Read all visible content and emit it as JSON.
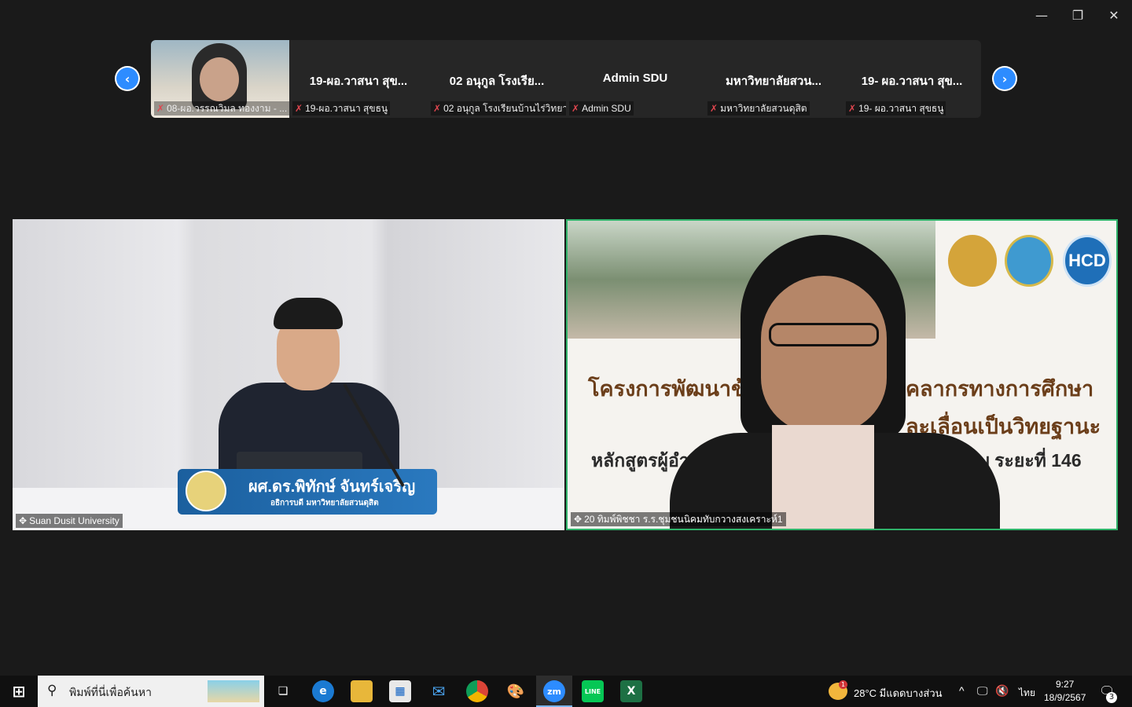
{
  "window": {
    "minimize_glyph": "—",
    "restore_glyph": "❐",
    "close_glyph": "✕"
  },
  "filmstrip": {
    "prev_glyph": "‹",
    "next_glyph": "›",
    "tiles": [
      {
        "name": "",
        "label": "08-ผอ.วรรณวิมล ทองงาม - ..."
      },
      {
        "name": "19-ผอ.วาสนา สุข...",
        "label": "19-ผอ.วาสนา สุขธนู"
      },
      {
        "name": "02 อนุกูล โรงเรีย...",
        "label": "02 อนุกูล โรงเรียนบ้านไร่วิทยา"
      },
      {
        "name": "Admin SDU",
        "label": "Admin SDU"
      },
      {
        "name": "มหาวิทยาลัยสวน...",
        "label": "มหาวิทยาลัยสวนดุสิต"
      },
      {
        "name": "19- ผอ.วาสนา สุข...",
        "label": "19- ผอ.วาสนา สุขธนู"
      }
    ]
  },
  "left_video": {
    "participant": "Suan Dusit University",
    "banner_name": "ผศ.ดร.พิทักษ์ จันทร์เจริญ",
    "banner_title": "อธิการบดี มหาวิทยาลัยสวนดุสิต"
  },
  "right_video": {
    "participant": "20 ทิมพ์พิชชา ร.ร.ชุมชนนิคมทับกวางสงเคราะห์1",
    "slide_line1a": "โครงการพัฒนาข้",
    "slide_line1b": "คลากรทางการศึกษา",
    "slide_line2": "ละเลื่อนเป็นวิทยฐานะ",
    "slide_line3a": "หลักสูตรผู้อำนว",
    "slide_line3b": "ชำนาญ ระยะที่ 146",
    "logo_hcd": "HCD"
  },
  "taskbar": {
    "search_placeholder": "พิมพ์ที่นี่เพื่อค้นหา",
    "weather": "28°C  มีแดดบางส่วน",
    "language": "ไทย",
    "time": "9:27",
    "date": "18/9/2567",
    "notification_count": "3",
    "weather_badge": "1",
    "zoom_label": "zm",
    "line_label": "LINE",
    "excel_label": "X"
  },
  "colors": {
    "accent_blue": "#2d8cff",
    "active_border": "#2fb36a",
    "mic_off": "#e0464f"
  }
}
